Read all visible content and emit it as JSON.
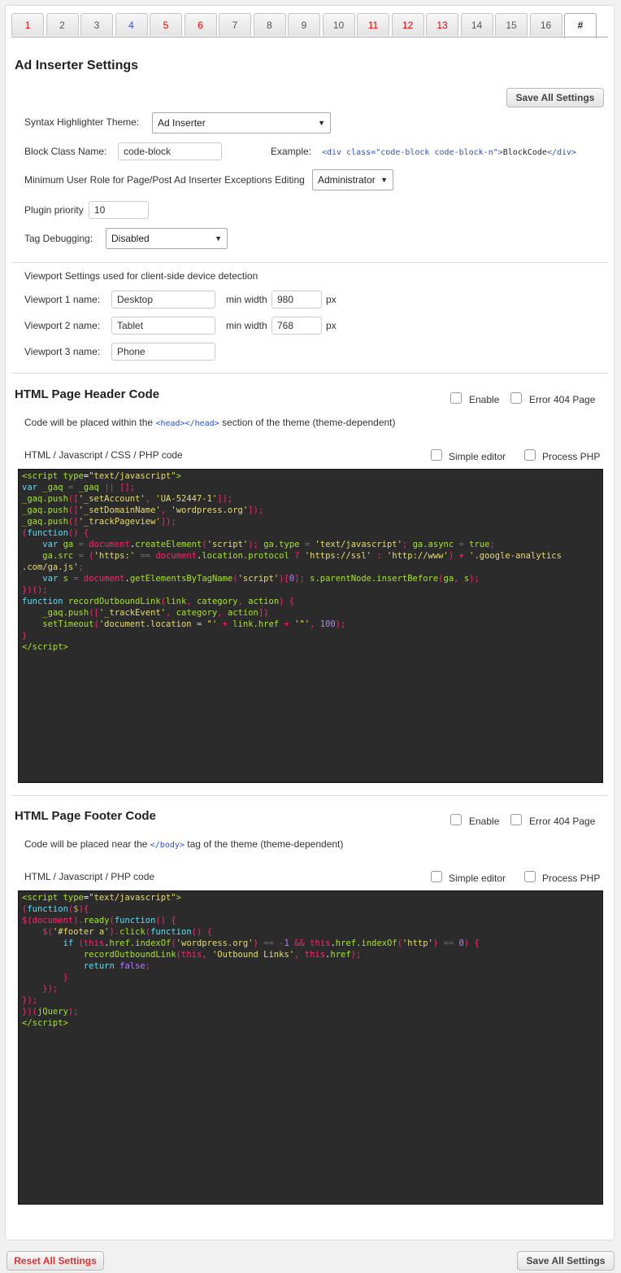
{
  "tabs": [
    {
      "label": "1",
      "color": "red"
    },
    {
      "label": "2",
      "color": "normal"
    },
    {
      "label": "3",
      "color": "normal"
    },
    {
      "label": "4",
      "color": "blue"
    },
    {
      "label": "5",
      "color": "red"
    },
    {
      "label": "6",
      "color": "red"
    },
    {
      "label": "7",
      "color": "normal"
    },
    {
      "label": "8",
      "color": "normal"
    },
    {
      "label": "9",
      "color": "normal"
    },
    {
      "label": "10",
      "color": "normal"
    },
    {
      "label": "11",
      "color": "red"
    },
    {
      "label": "12",
      "color": "red"
    },
    {
      "label": "13",
      "color": "red"
    },
    {
      "label": "14",
      "color": "normal"
    },
    {
      "label": "15",
      "color": "normal"
    },
    {
      "label": "16",
      "color": "normal"
    },
    {
      "label": "#",
      "color": "active"
    }
  ],
  "title": "Ad Inserter Settings",
  "save_all_label": "Save All Settings",
  "reset_all_label": "Reset All Settings",
  "settings": {
    "syntax_theme_label": "Syntax Highlighter Theme:",
    "syntax_theme_value": "Ad Inserter",
    "block_class_label": "Block Class Name:",
    "block_class_value": "code-block",
    "example_label": "Example:",
    "example_open": "<div class=\"code-block code-block-n\">",
    "example_text": "BlockCode",
    "example_close": "</div>",
    "min_role_label": "Minimum User Role for Page/Post Ad Inserter Exceptions Editing",
    "min_role_value": "Administrator",
    "priority_label": "Plugin priority",
    "priority_value": "10",
    "debug_label": "Tag Debugging:",
    "debug_value": "Disabled"
  },
  "viewports": {
    "heading": "Viewport Settings used for client-side device detection",
    "vp1_label": "Viewport 1 name:",
    "vp1_name": "Desktop",
    "vp1_width": "980",
    "vp2_label": "Viewport 2 name:",
    "vp2_name": "Tablet",
    "vp2_width": "768",
    "vp3_label": "Viewport 3 name:",
    "vp3_name": "Phone",
    "min_width_label": "min width",
    "px_label": "px"
  },
  "header_code": {
    "title": "HTML Page Header Code",
    "enable_label": "Enable",
    "error404_label": "Error 404 Page",
    "desc_before": "Code will be placed within the ",
    "desc_tag": "<head></head>",
    "desc_after": " section of the theme (theme-dependent)",
    "editor_label": "HTML / Javascript / CSS / PHP code",
    "simple_editor_label": "Simple editor",
    "process_php_label": "Process PHP"
  },
  "footer_code": {
    "title": "HTML Page Footer Code",
    "enable_label": "Enable",
    "error404_label": "Error 404 Page",
    "desc_before": "Code will be placed near the ",
    "desc_tag": "</body>",
    "desc_after": " tag of the theme (theme-dependent)",
    "editor_label": "HTML / Javascript / PHP code",
    "simple_editor_label": "Simple editor",
    "process_php_label": "Process PHP"
  },
  "icons": {
    "dropdown": "chevron-down-icon",
    "checkbox": "checkbox-icon"
  },
  "colors": {
    "accent_red": "#e00000",
    "accent_blue": "#3a55d9",
    "editor_bg": "#2b2b2b"
  }
}
